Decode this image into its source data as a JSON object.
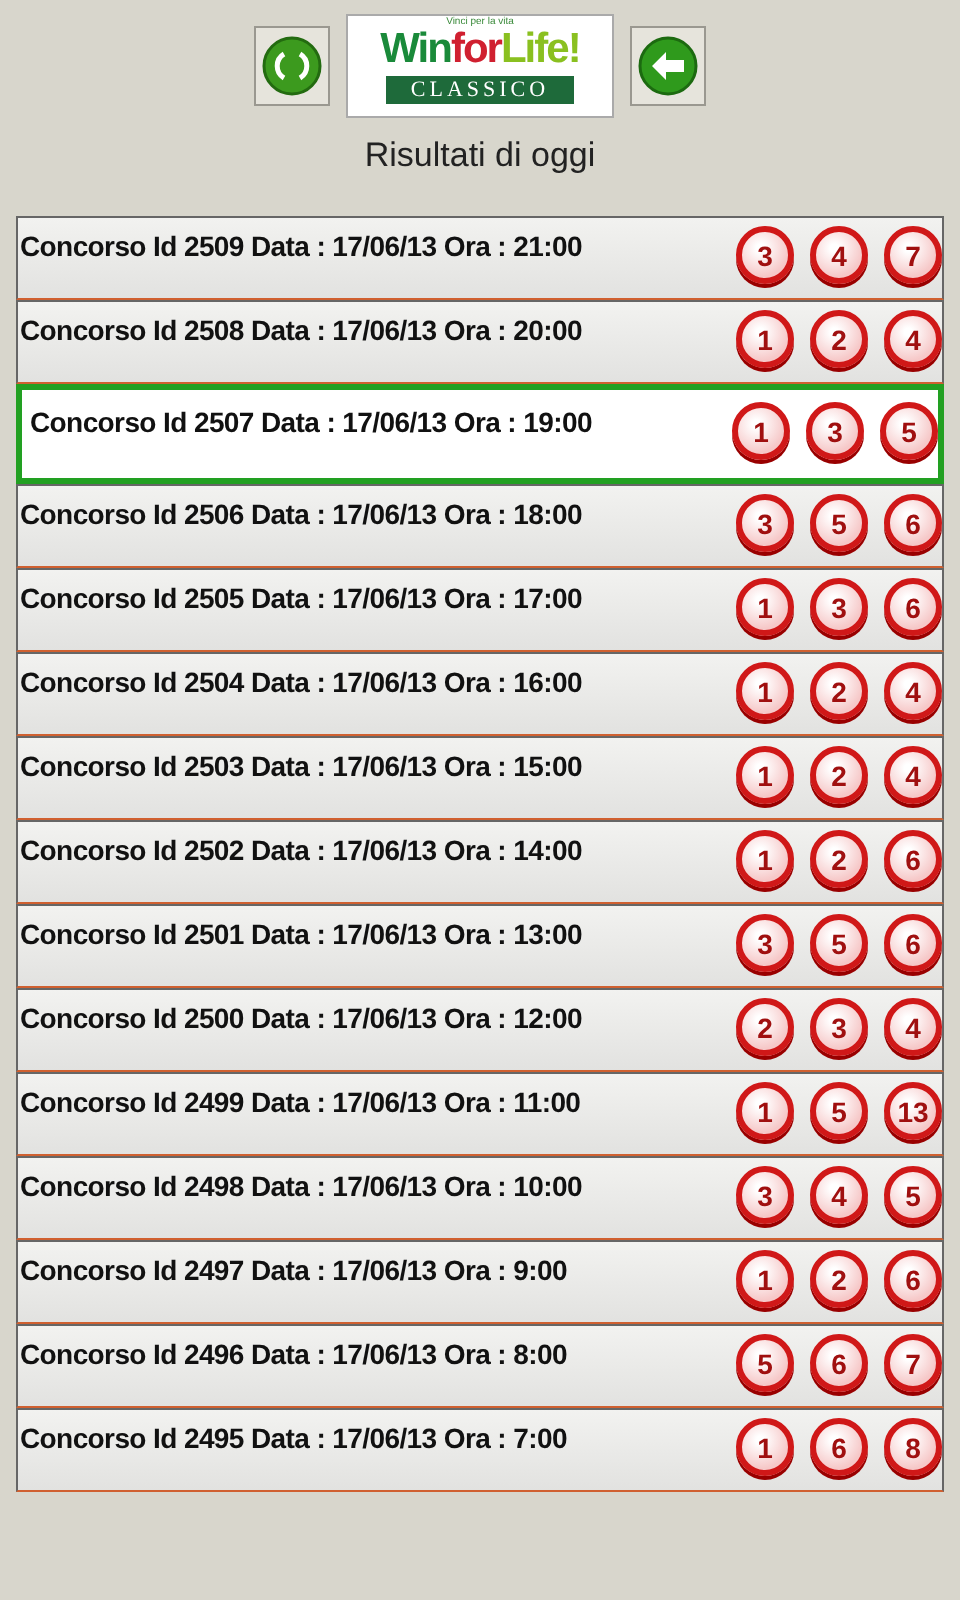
{
  "header": {
    "logo": {
      "tagline": "Vinci per la vita",
      "brand_win": "Win",
      "brand_for": "for",
      "brand_life": "Life!",
      "edition": "CLASSICO"
    },
    "title": "Risultati di oggi"
  },
  "draws": [
    {
      "label": "Concorso Id 2509 Data : 17/06/13 Ora : 21:00",
      "numbers": [
        "3",
        "4",
        "7"
      ],
      "selected": false
    },
    {
      "label": "Concorso Id 2508 Data : 17/06/13 Ora : 20:00",
      "numbers": [
        "1",
        "2",
        "4"
      ],
      "selected": false
    },
    {
      "label": "Concorso Id 2507 Data : 17/06/13 Ora : 19:00",
      "numbers": [
        "1",
        "3",
        "5"
      ],
      "selected": true
    },
    {
      "label": "Concorso Id 2506 Data : 17/06/13 Ora : 18:00",
      "numbers": [
        "3",
        "5",
        "6"
      ],
      "selected": false
    },
    {
      "label": "Concorso Id 2505 Data : 17/06/13 Ora : 17:00",
      "numbers": [
        "1",
        "3",
        "6"
      ],
      "selected": false
    },
    {
      "label": "Concorso Id 2504 Data : 17/06/13 Ora : 16:00",
      "numbers": [
        "1",
        "2",
        "4"
      ],
      "selected": false
    },
    {
      "label": "Concorso Id 2503 Data : 17/06/13 Ora : 15:00",
      "numbers": [
        "1",
        "2",
        "4"
      ],
      "selected": false
    },
    {
      "label": "Concorso Id 2502 Data : 17/06/13 Ora : 14:00",
      "numbers": [
        "1",
        "2",
        "6"
      ],
      "selected": false
    },
    {
      "label": "Concorso Id 2501 Data : 17/06/13 Ora : 13:00",
      "numbers": [
        "3",
        "5",
        "6"
      ],
      "selected": false
    },
    {
      "label": "Concorso Id 2500 Data : 17/06/13 Ora : 12:00",
      "numbers": [
        "2",
        "3",
        "4"
      ],
      "selected": false
    },
    {
      "label": "Concorso Id 2499 Data : 17/06/13 Ora : 11:00",
      "numbers": [
        "1",
        "5",
        "13"
      ],
      "selected": false
    },
    {
      "label": "Concorso Id 2498 Data : 17/06/13 Ora : 10:00",
      "numbers": [
        "3",
        "4",
        "5"
      ],
      "selected": false
    },
    {
      "label": "Concorso Id 2497 Data : 17/06/13 Ora : 9:00",
      "numbers": [
        "1",
        "2",
        "6"
      ],
      "selected": false
    },
    {
      "label": "Concorso Id 2496 Data : 17/06/13 Ora : 8:00",
      "numbers": [
        "5",
        "6",
        "7"
      ],
      "selected": false
    },
    {
      "label": "Concorso Id 2495 Data : 17/06/13 Ora : 7:00",
      "numbers": [
        "1",
        "6",
        "8"
      ],
      "selected": false
    }
  ]
}
